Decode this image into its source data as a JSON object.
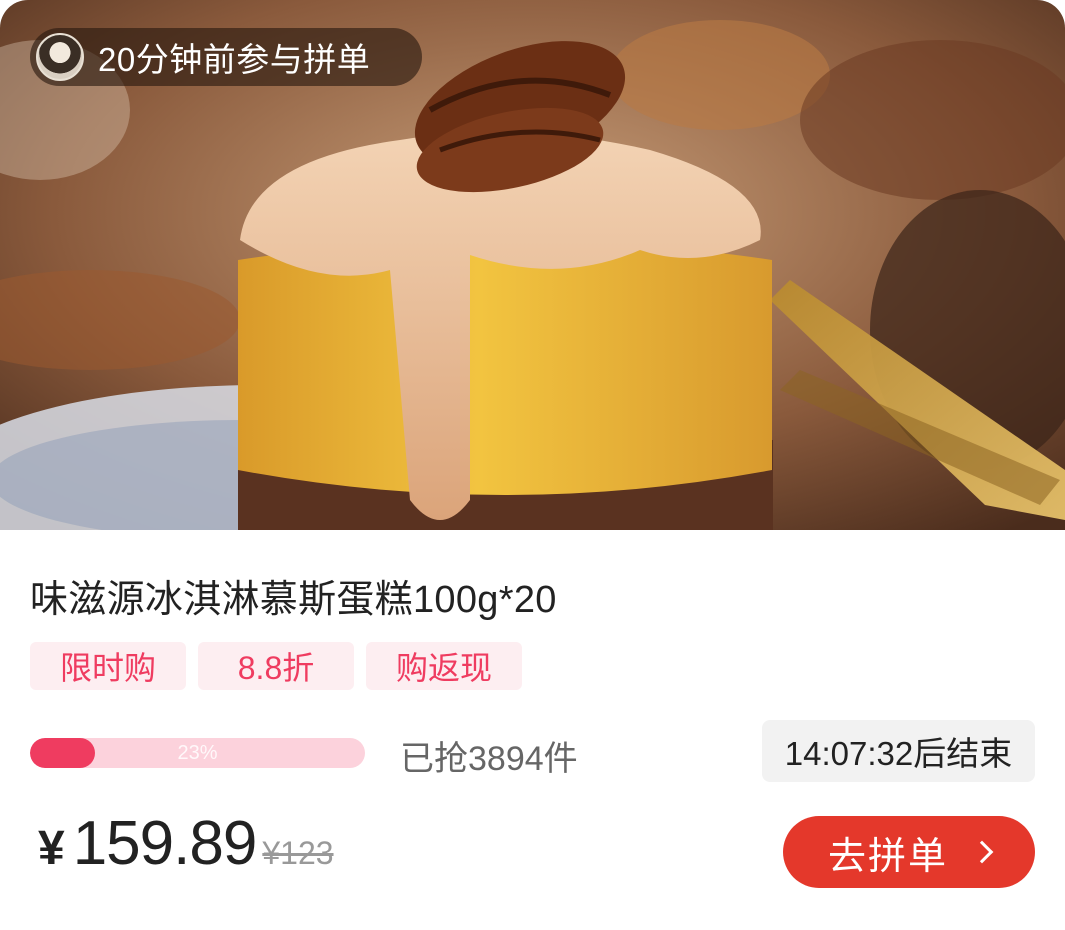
{
  "join_notice": {
    "text": "20分钟前参与拼单"
  },
  "product": {
    "title": "味滋源冰淇淋慕斯蛋糕100g*20",
    "tags": [
      "限时购",
      "8.8折",
      "购返现"
    ],
    "progress": {
      "percent": 23,
      "label": "23%"
    },
    "sold_text": "已抢3894件",
    "countdown_text": "14:07:32后结束",
    "price": {
      "currency": "¥",
      "amount": "159.89",
      "original": "¥123"
    },
    "cta_label": "去拼单"
  },
  "colors": {
    "accent": "#ef3c60",
    "cta": "#e4382b",
    "tag_bg": "#fdeef1",
    "progress_track": "#fcd2dc"
  },
  "icons": {
    "cta": "chevron-right-icon",
    "avatar": "user-avatar"
  }
}
